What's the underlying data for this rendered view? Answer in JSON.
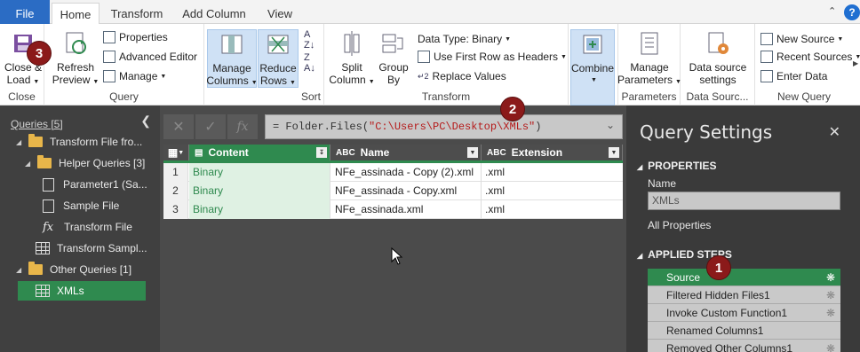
{
  "tabs": {
    "file": "File",
    "items": [
      "Home",
      "Transform",
      "Add Column",
      "View"
    ],
    "active": "Home"
  },
  "ribbon": {
    "close": {
      "close_load": "Close &\nLoad",
      "label_a": "Close &",
      "label_b": "Load",
      "group": "Close"
    },
    "query": {
      "refresh_a": "Refresh",
      "refresh_b": "Preview",
      "properties": "Properties",
      "advanced_editor": "Advanced Editor",
      "manage": "Manage",
      "group": "Query"
    },
    "manage_columns_a": "Manage",
    "manage_columns_b": "Columns",
    "reduce_rows_a": "Reduce",
    "reduce_rows_b": "Rows",
    "sort_group": "Sort",
    "split_a": "Split",
    "split_b": "Column",
    "group_a": "Group",
    "group_b": "By",
    "data_type": "Data Type: Binary",
    "first_row": "Use First Row as Headers",
    "replace": "Replace Values",
    "transform_group": "Transform",
    "combine": "Combine",
    "manage_params_a": "Manage",
    "manage_params_b": "Parameters",
    "params_group": "Parameters",
    "ds_settings_a": "Data source",
    "ds_settings_b": "settings",
    "ds_group": "Data Sourc...",
    "new_source": "New Source",
    "recent_sources": "Recent Sources",
    "enter_data": "Enter Data",
    "new_query_group": "New Query"
  },
  "queries": {
    "header": "Queries [5]",
    "items": [
      {
        "label": "Transform File fro..."
      },
      {
        "label": "Helper Queries [3]"
      },
      {
        "label": "Parameter1 (Sa..."
      },
      {
        "label": "Sample File"
      },
      {
        "label": "Transform File"
      },
      {
        "label": "Transform Sampl..."
      },
      {
        "label": "Other Queries [1]"
      },
      {
        "label": "XMLs"
      }
    ]
  },
  "formula": {
    "prefix": "= Folder.Files(",
    "string": "\"C:\\Users\\PC\\Desktop\\XMLs\"",
    "suffix": ")"
  },
  "table": {
    "columns": [
      {
        "type": "",
        "name": "Content"
      },
      {
        "type": "ABC",
        "name": "Name"
      },
      {
        "type": "ABC",
        "name": "Extension"
      }
    ],
    "rows": [
      {
        "num": "1",
        "content": "Binary",
        "name": "NFe_assinada - Copy (2).xml",
        "ext": ".xml"
      },
      {
        "num": "2",
        "content": "Binary",
        "name": "NFe_assinada - Copy.xml",
        "ext": ".xml"
      },
      {
        "num": "3",
        "content": "Binary",
        "name": "NFe_assinada.xml",
        "ext": ".xml"
      }
    ]
  },
  "settings": {
    "title": "Query Settings",
    "properties_head": "PROPERTIES",
    "name_label": "Name",
    "name_value": "XMLs",
    "all_properties": "All Properties",
    "steps_head": "APPLIED STEPS",
    "steps": [
      "Source",
      "Filtered Hidden Files1",
      "Invoke Custom Function1",
      "Renamed Columns1",
      "Removed Other Columns1"
    ]
  },
  "badges": [
    "1",
    "2",
    "3"
  ],
  "colors": {
    "accent_green": "#2f8a4f",
    "file_blue": "#2b6cc4",
    "badge_red": "#8b1a1a"
  }
}
